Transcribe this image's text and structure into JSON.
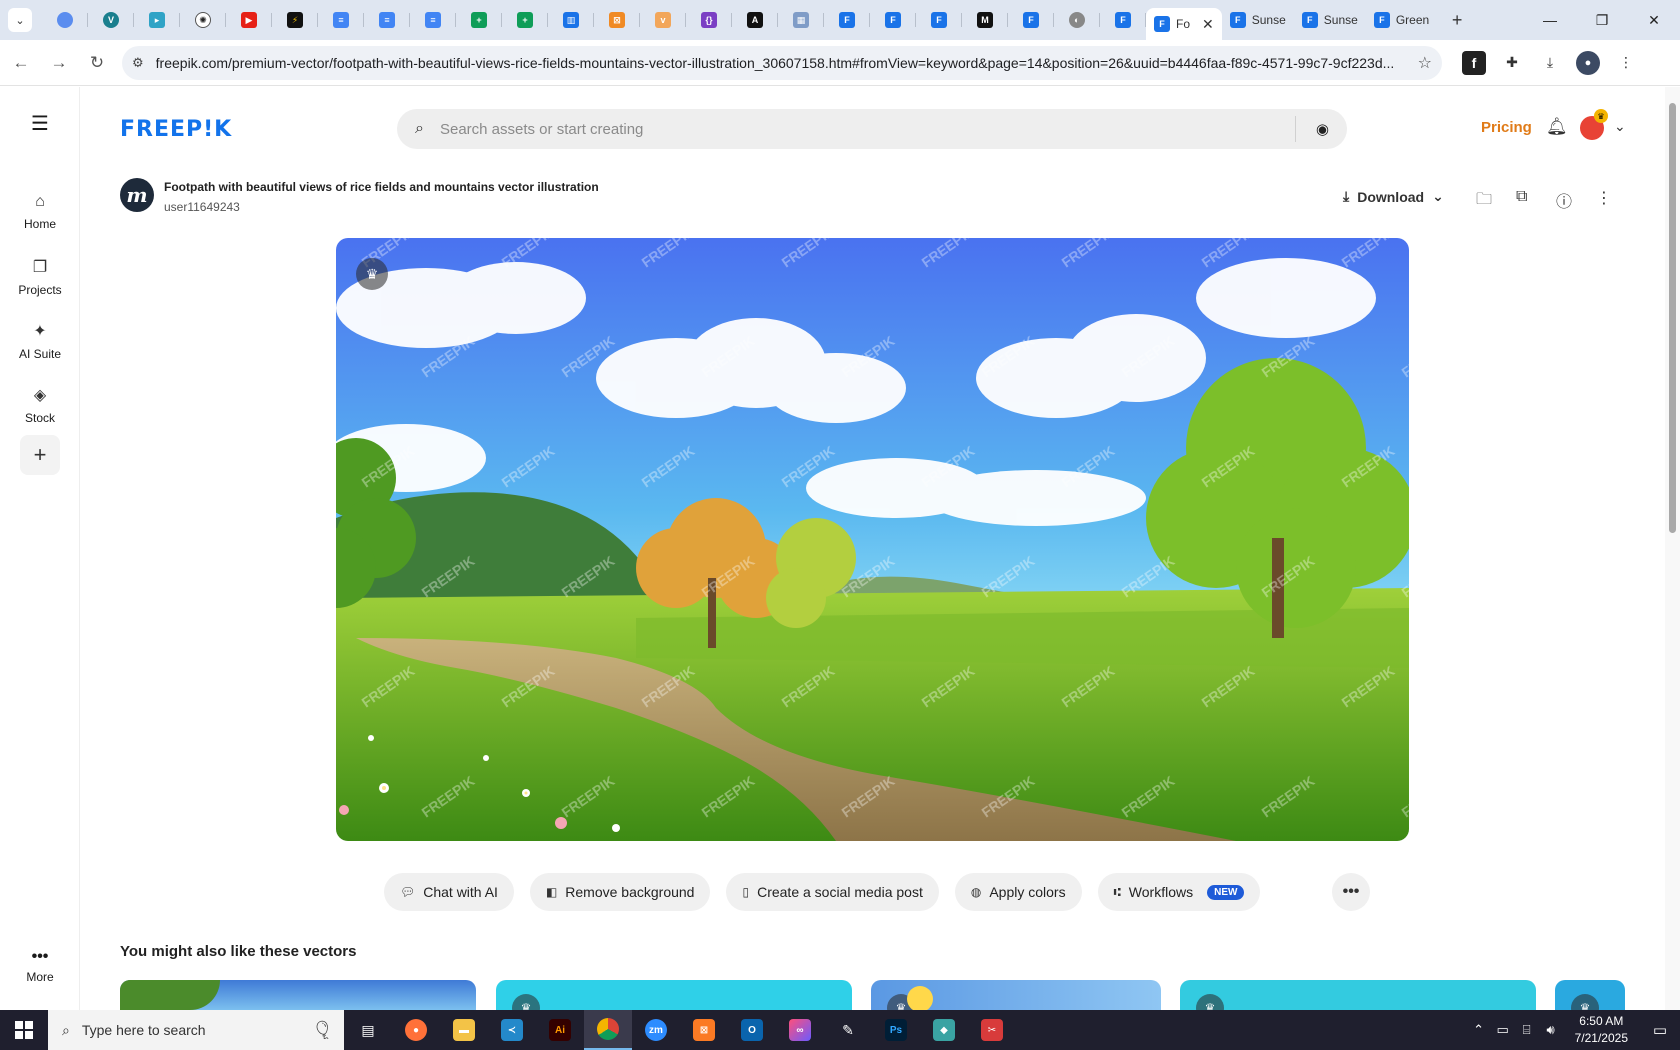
{
  "browser": {
    "active_tab_label": "Fo",
    "tab_2_label": "Sunse",
    "tab_3_label": "Sunse",
    "tab_4_label": "Green",
    "url": "freepik.com/premium-vector/footpath-with-beautiful-views-rice-fields-mountains-vector-illustration_30607158.htm#fromView=keyword&page=14&position=26&uuid=b4446faa-f89c-4571-99c7-9cf223d..."
  },
  "sidebar": {
    "items": [
      {
        "label": "Home"
      },
      {
        "label": "Projects"
      },
      {
        "label": "AI Suite"
      },
      {
        "label": "Stock"
      }
    ],
    "more_label": "More"
  },
  "header": {
    "logo": "FREEP!K",
    "search_placeholder": "Search assets or start creating",
    "pricing": "Pricing"
  },
  "asset": {
    "title": "Footpath with beautiful views of rice fields and mountains vector illustration",
    "author": "user11649243",
    "download_label": "Download",
    "watermark": "FREEPIK"
  },
  "chips": {
    "chat": "Chat with AI",
    "remove_bg": "Remove background",
    "social": "Create a social media post",
    "colors": "Apply colors",
    "workflows": "Workflows",
    "new_badge": "NEW"
  },
  "related": {
    "title": "You might also like these vectors"
  },
  "taskbar": {
    "search_placeholder": "Type here to search",
    "time": "6:50 AM",
    "date": "7/21/2025"
  },
  "colors": {
    "brand": "#1273eb",
    "pricing": "#e07b18",
    "new_badge": "#1e5bd8"
  }
}
